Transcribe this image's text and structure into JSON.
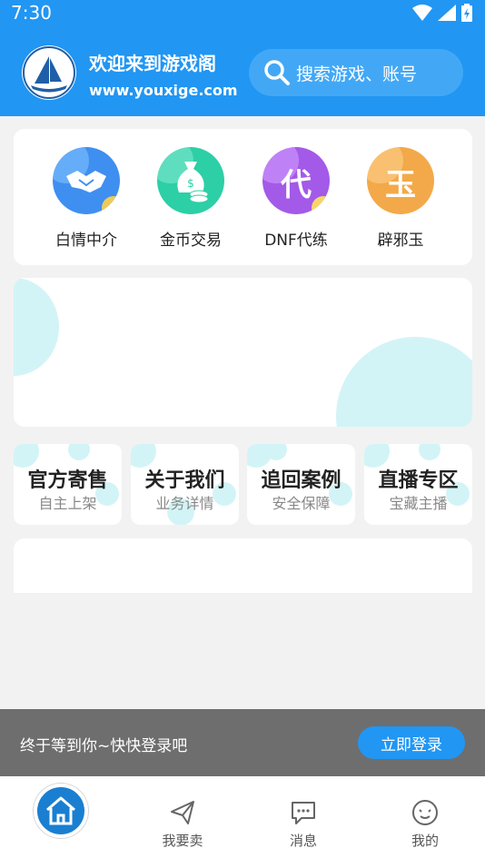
{
  "status": {
    "time": "7:30"
  },
  "header": {
    "logo_text": "游戏阁",
    "title": "欢迎来到游戏阁",
    "url": "www.youxige.com",
    "search_placeholder": "搜索游戏、账号"
  },
  "nav": [
    {
      "label": "白情中介",
      "icon": "handshake-icon",
      "color": "#3f8ff0"
    },
    {
      "label": "金币交易",
      "icon": "money-bag-icon",
      "color": "#2dcfa6"
    },
    {
      "label": "DNF代练",
      "icon": "dai-char-icon",
      "color": "#a35ae8",
      "char": "代"
    },
    {
      "label": "辟邪玉",
      "icon": "jade-char-icon",
      "color": "#f3a949",
      "char": "玉"
    }
  ],
  "tiles": [
    {
      "title": "官方寄售",
      "subtitle": "自主上架"
    },
    {
      "title": "关于我们",
      "subtitle": "业务详情"
    },
    {
      "title": "追回案例",
      "subtitle": "安全保障"
    },
    {
      "title": "直播专区",
      "subtitle": "宝藏主播"
    }
  ],
  "login": {
    "text": "终于等到你~快快登录吧",
    "button": "立即登录"
  },
  "tabs": [
    {
      "label": "",
      "icon": "home-icon"
    },
    {
      "label": "我要卖",
      "icon": "send-icon"
    },
    {
      "label": "消息",
      "icon": "message-icon"
    },
    {
      "label": "我的",
      "icon": "smile-face-icon"
    }
  ],
  "colors": {
    "primary": "#2196f3",
    "background": "#f2f2f2",
    "bubble": "#d3f4f6"
  }
}
